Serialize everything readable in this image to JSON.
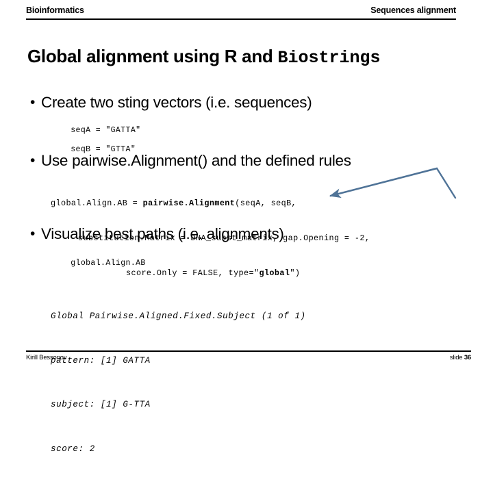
{
  "header": {
    "left_title": "Bioinformatics",
    "right_title": "Sequences alignment"
  },
  "title": {
    "prefix": "Global alignment using R and ",
    "package": "Biostrings"
  },
  "bullets": [
    {
      "marker": "•",
      "text": "Create two sting vectors (i.e. sequences)"
    },
    {
      "marker": "•",
      "text": "Use pairwise.Alignment() and the defined rules"
    },
    {
      "marker": "•",
      "text": "Visualize best paths (i.e. alignments)"
    }
  ],
  "code_seq": {
    "line1": "seqA = \"GATTA\"",
    "line2": "seqB = \"GTTA\""
  },
  "code_pairwise": {
    "line1_pre": "global.Align.AB = ",
    "line1_fn": "pairwise.Alignment",
    "line1_post": "(seqA, seqB,",
    "line2": "substitution.Matrix = DNA_subst_matrix, gap.Opening = -2,",
    "line3_pre": "score.Only = FALSE, type=\"",
    "line3_bold": "global",
    "line3_post": "\")"
  },
  "code_globalalign": {
    "line1": "global.Align.AB"
  },
  "output": {
    "line1": "Global Pairwise.Aligned.Fixed.Subject (1 of 1)",
    "line2": "pattern: [1] GATTA",
    "line3": "subject: [1] G-TTA",
    "line4": "score: 2"
  },
  "connector": {
    "color": "#4F7397"
  },
  "footer": {
    "author": "Kirill Bessonov",
    "slide_label": "slide ",
    "slide_number": "36"
  }
}
